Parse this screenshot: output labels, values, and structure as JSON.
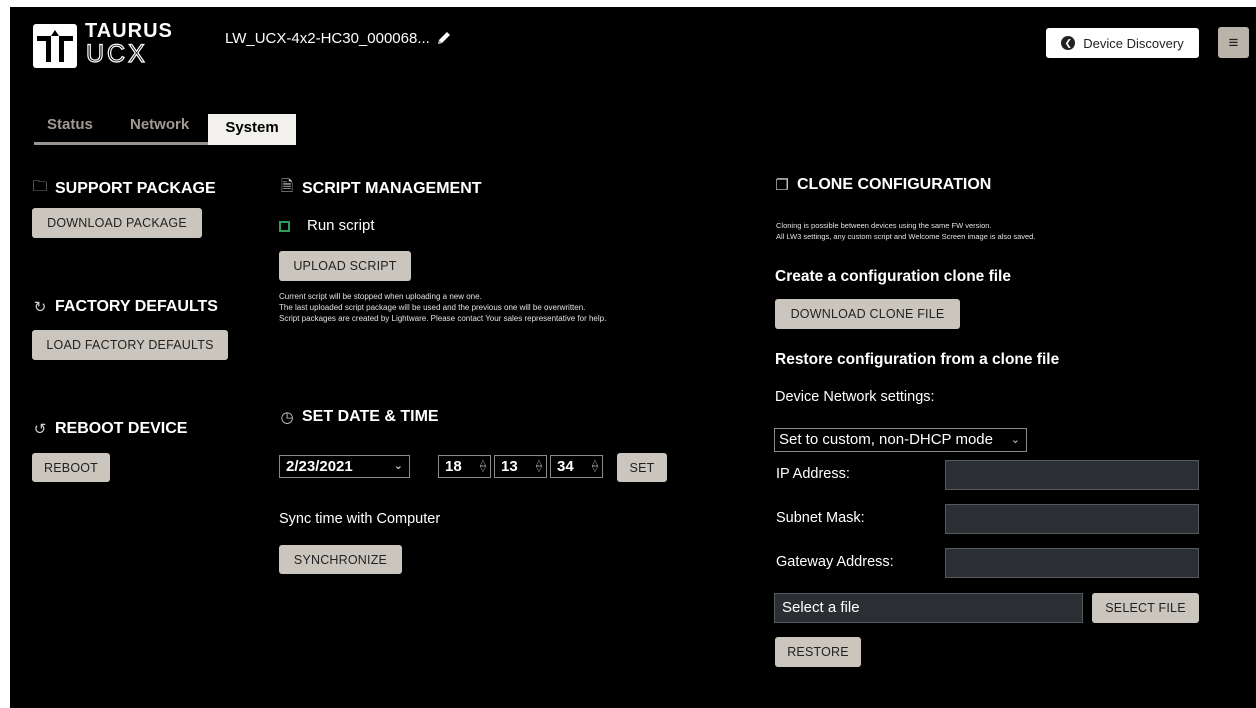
{
  "header": {
    "logo_top": "TAURUS",
    "logo_bottom": "UCX",
    "device_name": "LW_UCX-4x2-HC30_000068...",
    "discovery_label": "Device Discovery",
    "menu_icon": "≡"
  },
  "tabs": [
    {
      "label": "Status",
      "active": false
    },
    {
      "label": "Network",
      "active": false
    },
    {
      "label": "System",
      "active": true
    }
  ],
  "support": {
    "title": "SUPPORT PACKAGE",
    "button": "DOWNLOAD PACKAGE"
  },
  "factory": {
    "title": "FACTORY DEFAULTS",
    "button": "LOAD FACTORY DEFAULTS"
  },
  "reboot": {
    "title": "REBOOT DEVICE",
    "button": "REBOOT"
  },
  "script": {
    "title": "SCRIPT MANAGEMENT",
    "run_label": "Run script",
    "run_checked": false,
    "upload_button": "UPLOAD SCRIPT",
    "notes": [
      "Current script will be stopped when uploading a new one.",
      "The last uploaded script package will be used and the previous one will be overwritten.",
      "Script packages are created by Lightware. Please contact Your sales representative for help."
    ]
  },
  "datetime": {
    "title": "SET DATE & TIME",
    "date": "2/23/2021",
    "hour": "18",
    "minute": "13",
    "second": "34",
    "set_button": "SET",
    "sync_label": "Sync time with Computer",
    "sync_button": "SYNCHRONIZE"
  },
  "clone": {
    "title": "CLONE CONFIGURATION",
    "notes": [
      "Cloning is possible between devices using the same FW version.",
      "All LW3 settings, any custom script and Welcome Screen image is also saved."
    ],
    "create_heading": "Create a configuration clone file",
    "download_button": "DOWNLOAD CLONE FILE",
    "restore_heading": "Restore configuration from a clone file",
    "network_label": "Device Network settings:",
    "network_selected": "Set to custom, non-DHCP mode",
    "ip_label": "IP Address:",
    "ip_value": "",
    "subnet_label": "Subnet Mask:",
    "subnet_value": "",
    "gateway_label": "Gateway Address:",
    "gateway_value": "",
    "file_placeholder": "Select a file",
    "select_file_button": "SELECT FILE",
    "restore_button": "RESTORE"
  },
  "colors": {
    "background": "#000000",
    "button": "#cbc6bd",
    "checkbox_accent": "#2e9d5c",
    "field": "#2b2f33"
  }
}
